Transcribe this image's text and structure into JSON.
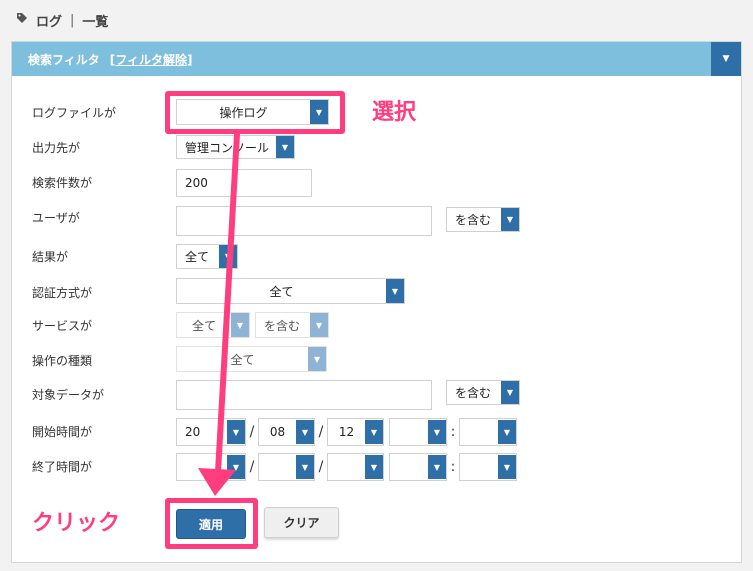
{
  "breadcrumb": {
    "log": "ログ",
    "sep": "|",
    "list": "一覧"
  },
  "panel": {
    "title": "検索フィルタ",
    "clear_filter": "[フィルタ解除]"
  },
  "form": {
    "logfile": {
      "label": "ログファイルが",
      "value": "操作ログ"
    },
    "output": {
      "label": "出力先が",
      "value": "管理コンソール"
    },
    "count": {
      "label": "検索件数が",
      "value": "200"
    },
    "user": {
      "label": "ユーザが",
      "value": "",
      "match": "を含む"
    },
    "result": {
      "label": "結果が",
      "value": "全て"
    },
    "auth": {
      "label": "認証方式が",
      "value": "全て"
    },
    "service": {
      "label": "サービスが",
      "value": "全て",
      "match": "を含む"
    },
    "optype": {
      "label": "操作の種類",
      "value": "全て"
    },
    "target": {
      "label": "対象データが",
      "value": "",
      "match": "を含む"
    },
    "start": {
      "label": "開始時間が",
      "year": "20",
      "month": "08",
      "day": "12",
      "hour": "",
      "minute": ""
    },
    "end": {
      "label": "終了時間が",
      "year": "",
      "month": "",
      "day": "",
      "hour": "",
      "minute": ""
    }
  },
  "buttons": {
    "apply": "適用",
    "clear": "クリア"
  },
  "annotations": {
    "select": "選択",
    "click": "クリック"
  },
  "colors": {
    "accent": "#2f6fa8",
    "header": "#7dbfdd",
    "highlight": "#ff3d7f"
  }
}
